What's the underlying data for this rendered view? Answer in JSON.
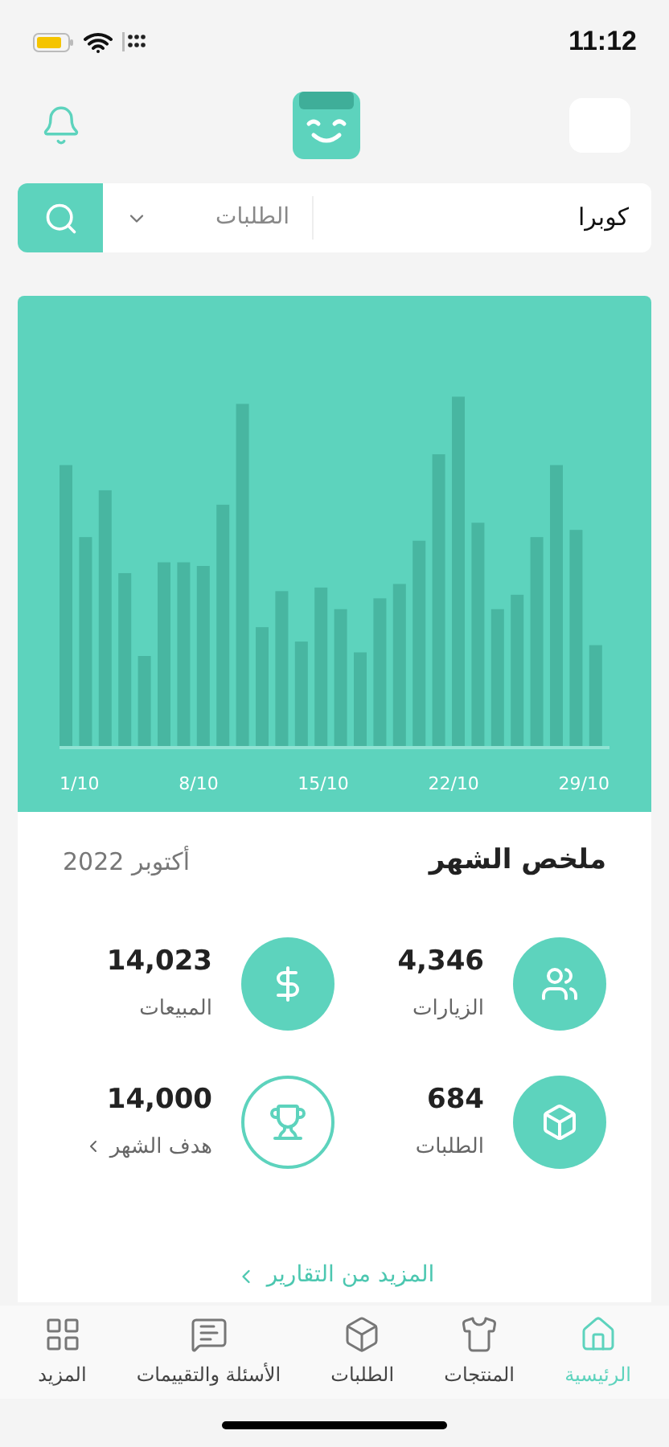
{
  "status_bar": {
    "time": "11:12"
  },
  "search": {
    "value": "كوبرا",
    "scope": "الطلبات"
  },
  "chart": {
    "x_labels": [
      "29/10",
      "22/10",
      "15/10",
      "8/10",
      "1/10"
    ]
  },
  "summary": {
    "title": "ملخص الشهر",
    "period": "أكتوبر 2022",
    "stats": [
      {
        "kind": "visits",
        "value": "4,346",
        "label": "الزيارات"
      },
      {
        "kind": "sales",
        "value": "14,023",
        "label": "المبيعات"
      },
      {
        "kind": "orders",
        "value": "684",
        "label": "الطلبات"
      },
      {
        "kind": "goal",
        "value": "14,000",
        "label": "هدف الشهر"
      }
    ],
    "more_link": "المزيد من التقارير"
  },
  "tabs": [
    {
      "kind": "home",
      "label": "الرئيسية",
      "selected": true
    },
    {
      "kind": "products",
      "label": "المنتجات",
      "selected": false
    },
    {
      "kind": "orders",
      "label": "الطلبات",
      "selected": false
    },
    {
      "kind": "reviews",
      "label": "الأسئلة والتقييمات",
      "selected": false
    },
    {
      "kind": "more",
      "label": "المزيد",
      "selected": false
    }
  ]
}
